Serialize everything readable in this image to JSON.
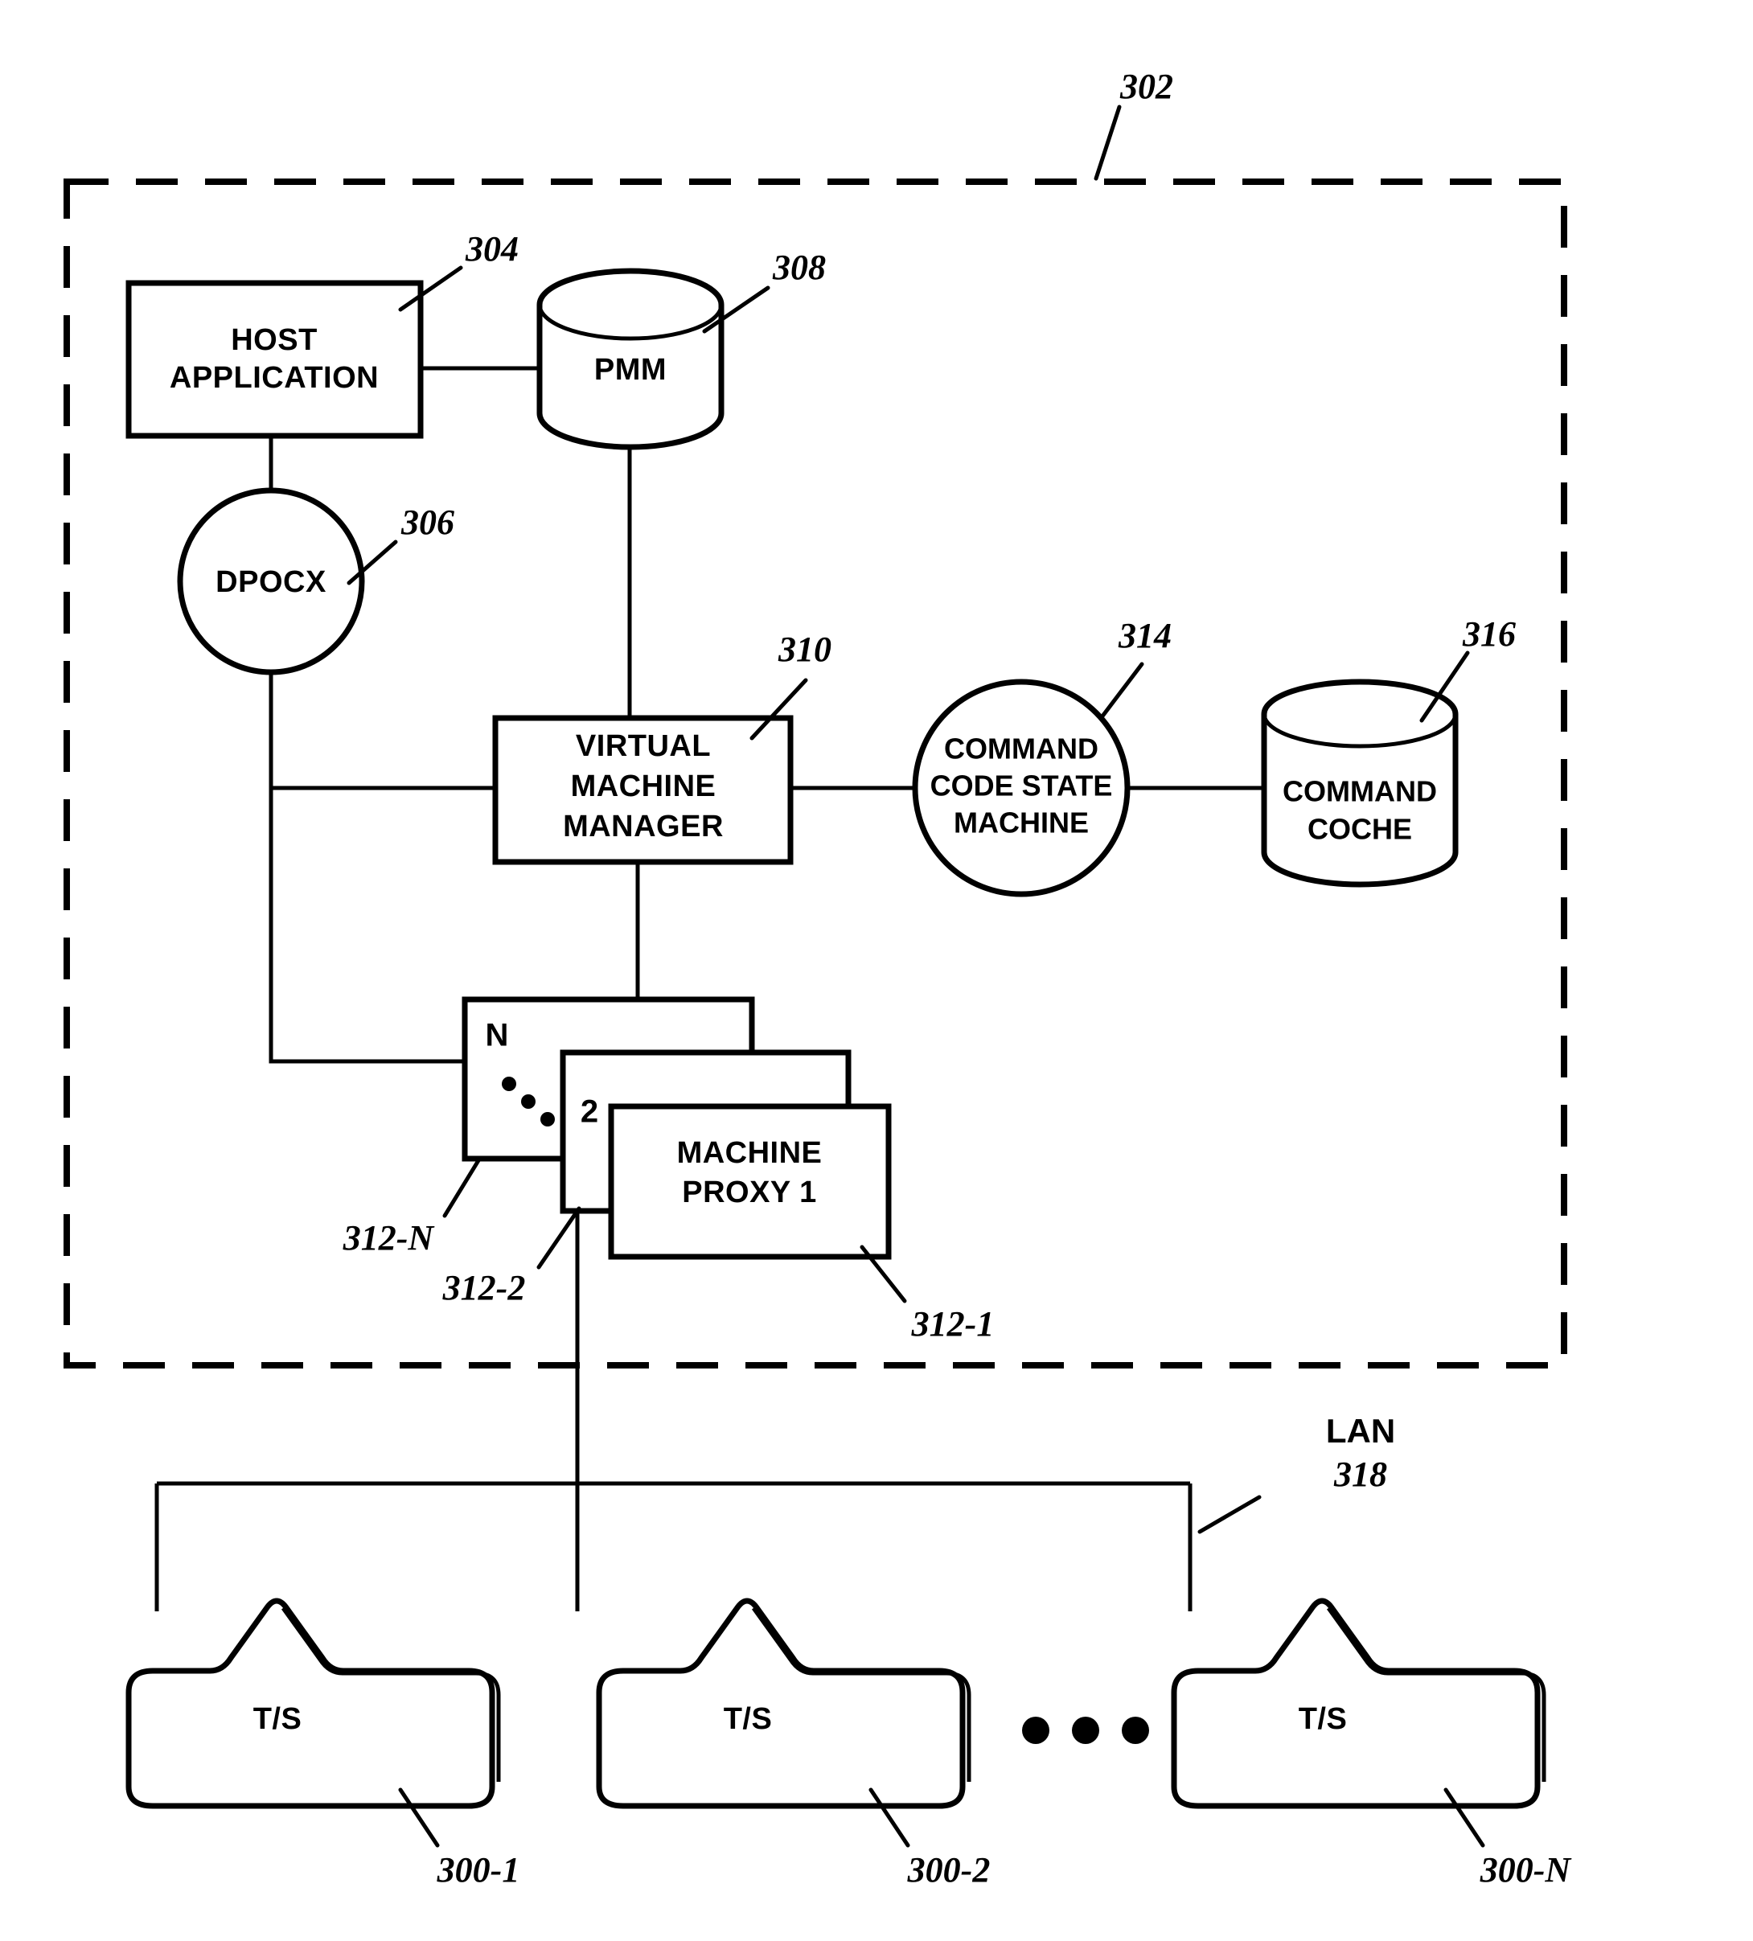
{
  "figure": {
    "system_boundary_ref": "302",
    "nodes": {
      "host_application": {
        "label_line1": "HOST",
        "label_line2": "APPLICATION",
        "ref": "304",
        "shape": "rectangle"
      },
      "pmm": {
        "label": "PMM",
        "ref": "308",
        "shape": "cylinder"
      },
      "dpocx": {
        "label": "DPOCX",
        "ref": "306",
        "shape": "circle"
      },
      "virtual_machine_manager": {
        "label_line1": "VIRTUAL",
        "label_line2": "MACHINE",
        "label_line3": "MANAGER",
        "ref": "310",
        "shape": "rectangle"
      },
      "command_code_state_machine": {
        "label_line1": "COMMAND",
        "label_line2": "CODE STATE",
        "label_line3": "MACHINE",
        "ref": "314",
        "shape": "circle"
      },
      "command_cache": {
        "label_line1": "COMMAND",
        "label_line2": "COCHE",
        "ref": "316",
        "shape": "cylinder"
      }
    },
    "machine_proxy_stack": {
      "front": {
        "label_line1": "MACHINE",
        "label_line2": "PROXY 1",
        "ref": "312-1"
      },
      "middle": {
        "badge": "2",
        "ref": "312-2"
      },
      "back": {
        "badge": "N",
        "ref": "312-N"
      },
      "ellipsis": "• • •"
    },
    "lan": {
      "label": "LAN",
      "ref": "318"
    },
    "terminals": [
      {
        "label": "T/S",
        "ref": "300-1"
      },
      {
        "label": "T/S",
        "ref": "300-2"
      },
      {
        "label": "T/S",
        "ref": "300-N"
      }
    ],
    "terminal_ellipsis": "• • •"
  },
  "colors": {
    "ink": "#000000",
    "paper": "#ffffff"
  }
}
